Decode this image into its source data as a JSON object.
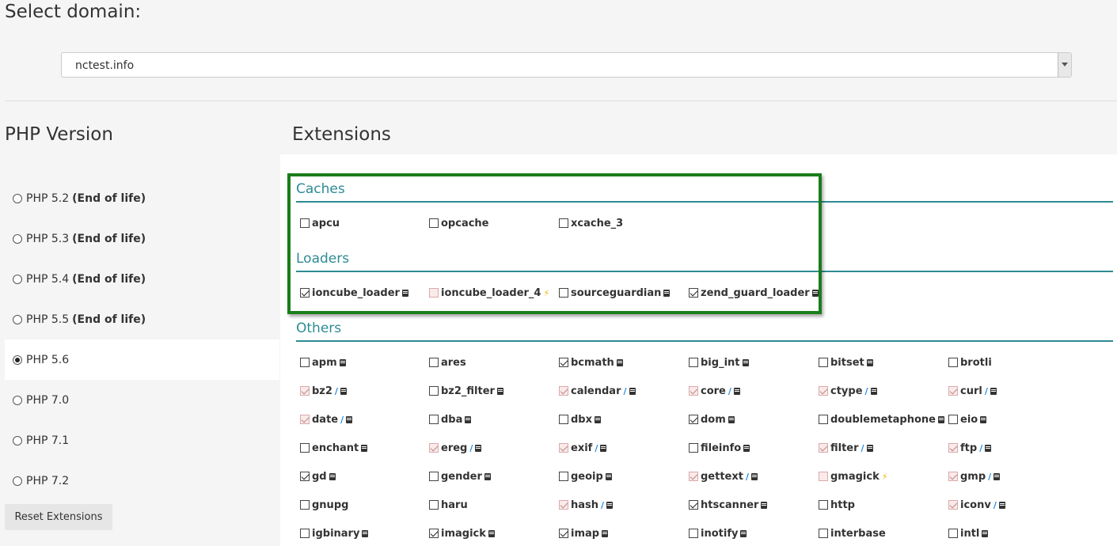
{
  "domain": {
    "title": "Select domain:",
    "selected": "nctest.info"
  },
  "php": {
    "title": "PHP Version",
    "versions": [
      {
        "label": "PHP 5.2",
        "note": "(End of life)",
        "selected": false
      },
      {
        "label": "PHP 5.3",
        "note": "(End of life)",
        "selected": false
      },
      {
        "label": "PHP 5.4",
        "note": "(End of life)",
        "selected": false
      },
      {
        "label": "PHP 5.5",
        "note": "(End of life)",
        "selected": false
      },
      {
        "label": "PHP 5.6",
        "note": "",
        "selected": true
      },
      {
        "label": "PHP 7.0",
        "note": "",
        "selected": false
      },
      {
        "label": "PHP 7.1",
        "note": "",
        "selected": false
      },
      {
        "label": "PHP 7.2",
        "note": "",
        "selected": false
      }
    ],
    "reset_label": "Reset Extensions"
  },
  "extensions": {
    "title": "Extensions",
    "sections": {
      "caches": {
        "title": "Caches",
        "items": [
          {
            "name": "apcu",
            "checked": false,
            "disabled": false,
            "icons": []
          },
          {
            "name": "opcache",
            "checked": false,
            "disabled": false,
            "icons": []
          },
          {
            "name": "xcache_3",
            "checked": false,
            "disabled": false,
            "icons": []
          }
        ]
      },
      "loaders": {
        "title": "Loaders",
        "items": [
          {
            "name": "ioncube_loader",
            "checked": true,
            "disabled": false,
            "icons": [
              "doc"
            ]
          },
          {
            "name": "ioncube_loader_4",
            "checked": false,
            "disabled": true,
            "icons": [
              "bolt"
            ]
          },
          {
            "name": "sourceguardian",
            "checked": false,
            "disabled": false,
            "icons": [
              "doc"
            ]
          },
          {
            "name": "zend_guard_loader",
            "checked": true,
            "disabled": false,
            "icons": [
              "doc"
            ]
          }
        ]
      },
      "others": {
        "title": "Others",
        "items": [
          {
            "name": "apm",
            "checked": false,
            "disabled": false,
            "icons": [
              "doc"
            ]
          },
          {
            "name": "ares",
            "checked": false,
            "disabled": false,
            "icons": []
          },
          {
            "name": "bcmath",
            "checked": true,
            "disabled": false,
            "icons": [
              "doc"
            ]
          },
          {
            "name": "big_int",
            "checked": false,
            "disabled": false,
            "icons": [
              "doc"
            ]
          },
          {
            "name": "bitset",
            "checked": false,
            "disabled": false,
            "icons": [
              "doc"
            ]
          },
          {
            "name": "brotli",
            "checked": false,
            "disabled": false,
            "icons": []
          },
          {
            "name": "bz2",
            "checked": true,
            "disabled": true,
            "icons": [
              "wrench",
              "doc"
            ]
          },
          {
            "name": "bz2_filter",
            "checked": false,
            "disabled": false,
            "icons": [
              "doc"
            ]
          },
          {
            "name": "calendar",
            "checked": true,
            "disabled": true,
            "icons": [
              "wrench",
              "doc"
            ]
          },
          {
            "name": "core",
            "checked": true,
            "disabled": true,
            "icons": [
              "wrench",
              "doc"
            ]
          },
          {
            "name": "ctype",
            "checked": true,
            "disabled": true,
            "icons": [
              "wrench",
              "doc"
            ]
          },
          {
            "name": "curl",
            "checked": true,
            "disabled": true,
            "icons": [
              "wrench",
              "doc"
            ]
          },
          {
            "name": "date",
            "checked": true,
            "disabled": true,
            "icons": [
              "wrench",
              "doc"
            ]
          },
          {
            "name": "dba",
            "checked": false,
            "disabled": false,
            "icons": [
              "doc"
            ]
          },
          {
            "name": "dbx",
            "checked": false,
            "disabled": false,
            "icons": [
              "doc"
            ]
          },
          {
            "name": "dom",
            "checked": true,
            "disabled": false,
            "icons": [
              "doc"
            ]
          },
          {
            "name": "doublemetaphone",
            "checked": false,
            "disabled": false,
            "icons": [
              "doc"
            ]
          },
          {
            "name": "eio",
            "checked": false,
            "disabled": false,
            "icons": [
              "doc"
            ]
          },
          {
            "name": "enchant",
            "checked": false,
            "disabled": false,
            "icons": [
              "doc"
            ]
          },
          {
            "name": "ereg",
            "checked": true,
            "disabled": true,
            "icons": [
              "wrench",
              "doc"
            ]
          },
          {
            "name": "exif",
            "checked": true,
            "disabled": true,
            "icons": [
              "wrench",
              "doc"
            ]
          },
          {
            "name": "fileinfo",
            "checked": false,
            "disabled": false,
            "icons": [
              "doc"
            ]
          },
          {
            "name": "filter",
            "checked": true,
            "disabled": true,
            "icons": [
              "wrench",
              "doc"
            ]
          },
          {
            "name": "ftp",
            "checked": true,
            "disabled": true,
            "icons": [
              "wrench",
              "doc"
            ]
          },
          {
            "name": "gd",
            "checked": true,
            "disabled": false,
            "icons": [
              "doc"
            ]
          },
          {
            "name": "gender",
            "checked": false,
            "disabled": false,
            "icons": [
              "doc"
            ]
          },
          {
            "name": "geoip",
            "checked": false,
            "disabled": false,
            "icons": [
              "doc"
            ]
          },
          {
            "name": "gettext",
            "checked": true,
            "disabled": true,
            "icons": [
              "wrench",
              "doc"
            ]
          },
          {
            "name": "gmagick",
            "checked": false,
            "disabled": true,
            "icons": [
              "bolt"
            ]
          },
          {
            "name": "gmp",
            "checked": true,
            "disabled": true,
            "icons": [
              "wrench",
              "doc"
            ]
          },
          {
            "name": "gnupg",
            "checked": false,
            "disabled": false,
            "icons": []
          },
          {
            "name": "haru",
            "checked": false,
            "disabled": false,
            "icons": []
          },
          {
            "name": "hash",
            "checked": true,
            "disabled": true,
            "icons": [
              "wrench",
              "doc"
            ]
          },
          {
            "name": "htscanner",
            "checked": true,
            "disabled": false,
            "icons": [
              "doc"
            ]
          },
          {
            "name": "http",
            "checked": false,
            "disabled": false,
            "icons": []
          },
          {
            "name": "iconv",
            "checked": true,
            "disabled": true,
            "icons": [
              "wrench",
              "doc"
            ]
          },
          {
            "name": "igbinary",
            "checked": false,
            "disabled": false,
            "icons": [
              "doc"
            ]
          },
          {
            "name": "imagick",
            "checked": true,
            "disabled": false,
            "icons": [
              "doc"
            ]
          },
          {
            "name": "imap",
            "checked": true,
            "disabled": false,
            "icons": [
              "doc"
            ]
          },
          {
            "name": "inotify",
            "checked": false,
            "disabled": false,
            "icons": [
              "doc"
            ]
          },
          {
            "name": "interbase",
            "checked": false,
            "disabled": false,
            "icons": []
          },
          {
            "name": "intl",
            "checked": false,
            "disabled": false,
            "icons": [
              "doc"
            ]
          }
        ]
      }
    }
  }
}
